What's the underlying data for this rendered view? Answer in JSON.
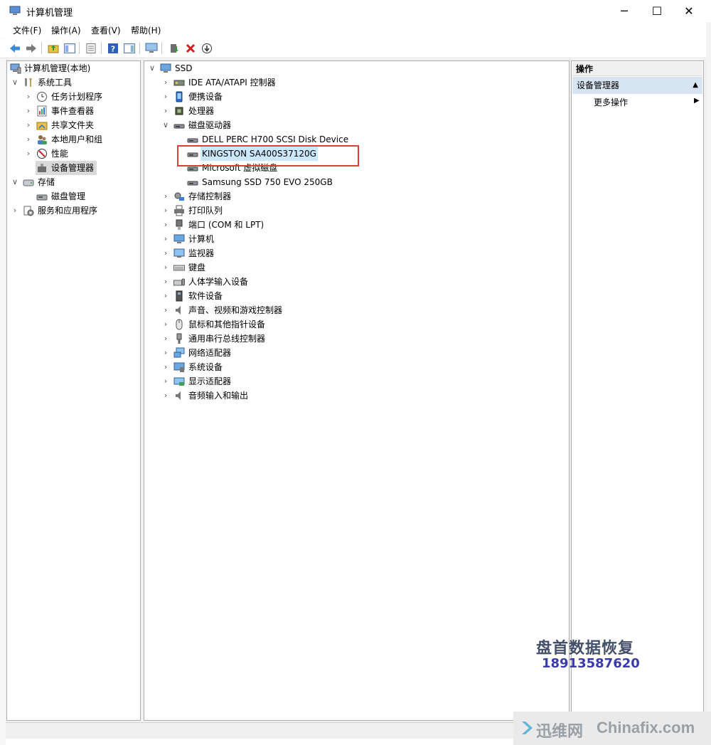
{
  "window": {
    "title": "计算机管理"
  },
  "menu": [
    "文件(F)",
    "操作(A)",
    "查看(V)",
    "帮助(H)"
  ],
  "left_tree": [
    {
      "label": "计算机管理(本地)",
      "expander": "",
      "level": 0
    },
    {
      "label": "系统工具",
      "expander": "expanded",
      "level": 1
    },
    {
      "label": "任务计划程序",
      "expander": "collapsed",
      "level": 2
    },
    {
      "label": "事件查看器",
      "expander": "collapsed",
      "level": 2
    },
    {
      "label": "共享文件夹",
      "expander": "collapsed",
      "level": 2
    },
    {
      "label": "本地用户和组",
      "expander": "collapsed",
      "level": 2
    },
    {
      "label": "性能",
      "expander": "collapsed",
      "level": 2
    },
    {
      "label": "设备管理器",
      "expander": "",
      "level": 2,
      "selected": true
    },
    {
      "label": "存储",
      "expander": "expanded",
      "level": 1
    },
    {
      "label": "磁盘管理",
      "expander": "",
      "level": 2
    },
    {
      "label": "服务和应用程序",
      "expander": "collapsed",
      "level": 1
    }
  ],
  "device_tree": {
    "root": "SSD",
    "categories": [
      {
        "label": "IDE ATA/ATAPI 控制器",
        "expanded": false
      },
      {
        "label": "便携设备",
        "expanded": false
      },
      {
        "label": "处理器",
        "expanded": false
      },
      {
        "label": "磁盘驱动器",
        "expanded": true,
        "children": [
          "DELL PERC H700 SCSI Disk Device",
          "KINGSTON SA400S37120G",
          "Microsoft 虚拟磁盘",
          "Samsung SSD 750 EVO 250GB"
        ]
      },
      {
        "label": "存储控制器",
        "expanded": false
      },
      {
        "label": "打印队列",
        "expanded": false
      },
      {
        "label": "端口 (COM 和 LPT)",
        "expanded": false
      },
      {
        "label": "计算机",
        "expanded": false
      },
      {
        "label": "监视器",
        "expanded": false
      },
      {
        "label": "键盘",
        "expanded": false
      },
      {
        "label": "人体学输入设备",
        "expanded": false
      },
      {
        "label": "软件设备",
        "expanded": false
      },
      {
        "label": "声音、视频和游戏控制器",
        "expanded": false
      },
      {
        "label": "鼠标和其他指针设备",
        "expanded": false
      },
      {
        "label": "通用串行总线控制器",
        "expanded": false
      },
      {
        "label": "网络适配器",
        "expanded": false
      },
      {
        "label": "系统设备",
        "expanded": false
      },
      {
        "label": "显示适配器",
        "expanded": false
      },
      {
        "label": "音频输入和输出",
        "expanded": false
      }
    ],
    "selected_device": "KINGSTON SA400S37120G"
  },
  "actions": {
    "header": "操作",
    "section": "设备管理器",
    "more": "更多操作"
  },
  "watermark": {
    "line1": "盘首数据恢复",
    "line2": "18913587620",
    "site_cn": "迅维网",
    "site_en": "Chinafix.com"
  },
  "colors": {
    "highlight_box": "#e03c3c",
    "selection": "#cce8ff",
    "action_section": "#d7e4f2"
  }
}
